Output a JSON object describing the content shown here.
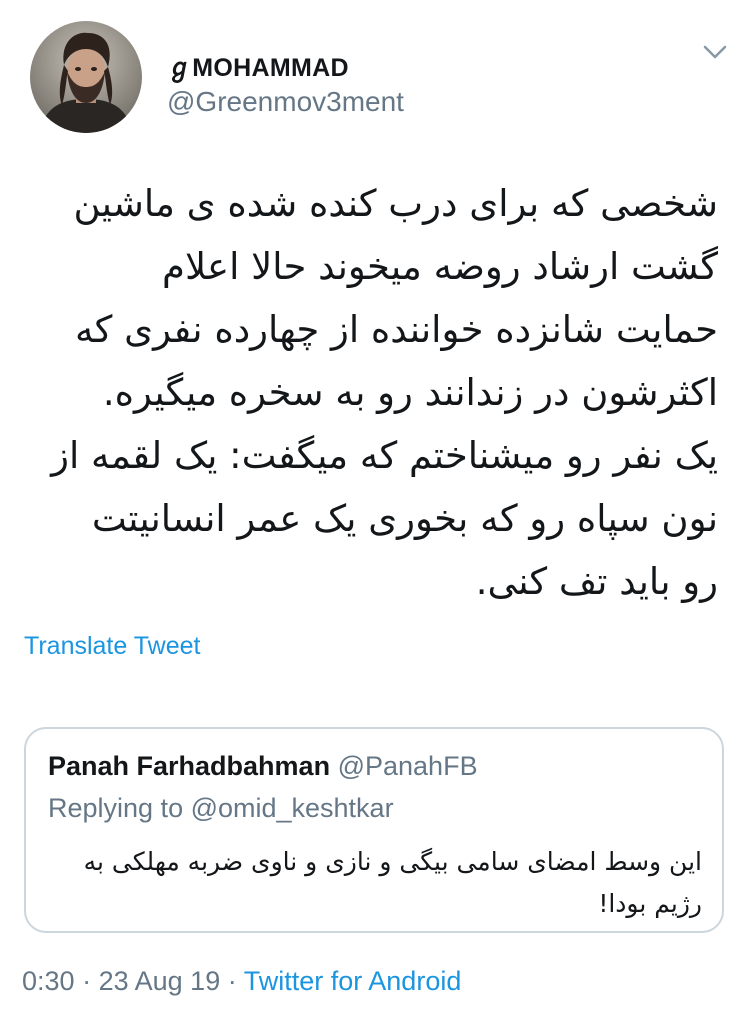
{
  "tweet": {
    "display_name": "ℊMOHAMMAD",
    "handle": "@Greenmov3ment",
    "text": "شخصی که برای درب کنده شده ی ماشین\nگشت ارشاد روضه میخوند حالا اعلام\nحمایت شانزده خواننده از چهارده نفری که\nاکثرشون در زندانند رو به سخره میگیره.\nیک نفر رو میشناختم که میگفت: یک لقمه از\nنون سپاه رو که بخوری یک عمر انسانیتت\nرو باید تف کنی.",
    "translate_label": "Translate Tweet",
    "time": "0:30",
    "separator": "·",
    "date": "23 Aug 19",
    "source": "Twitter for Android"
  },
  "quote": {
    "name": "Panah Farhadbahman",
    "handle": "@PanahFB",
    "replying_to": "Replying to @omid_keshtkar",
    "text": "این وسط امضای سامی بیگی و نازی و ناوی ضربه مهلکی به\nرژیم بودا!"
  },
  "icons": {
    "avatar": "avatar-portrait",
    "menu": "chevron-down-icon"
  },
  "colors": {
    "link": "#1b95e0",
    "secondary_text": "#657786",
    "border": "#ccd6dd",
    "primary_text": "#14171a"
  }
}
